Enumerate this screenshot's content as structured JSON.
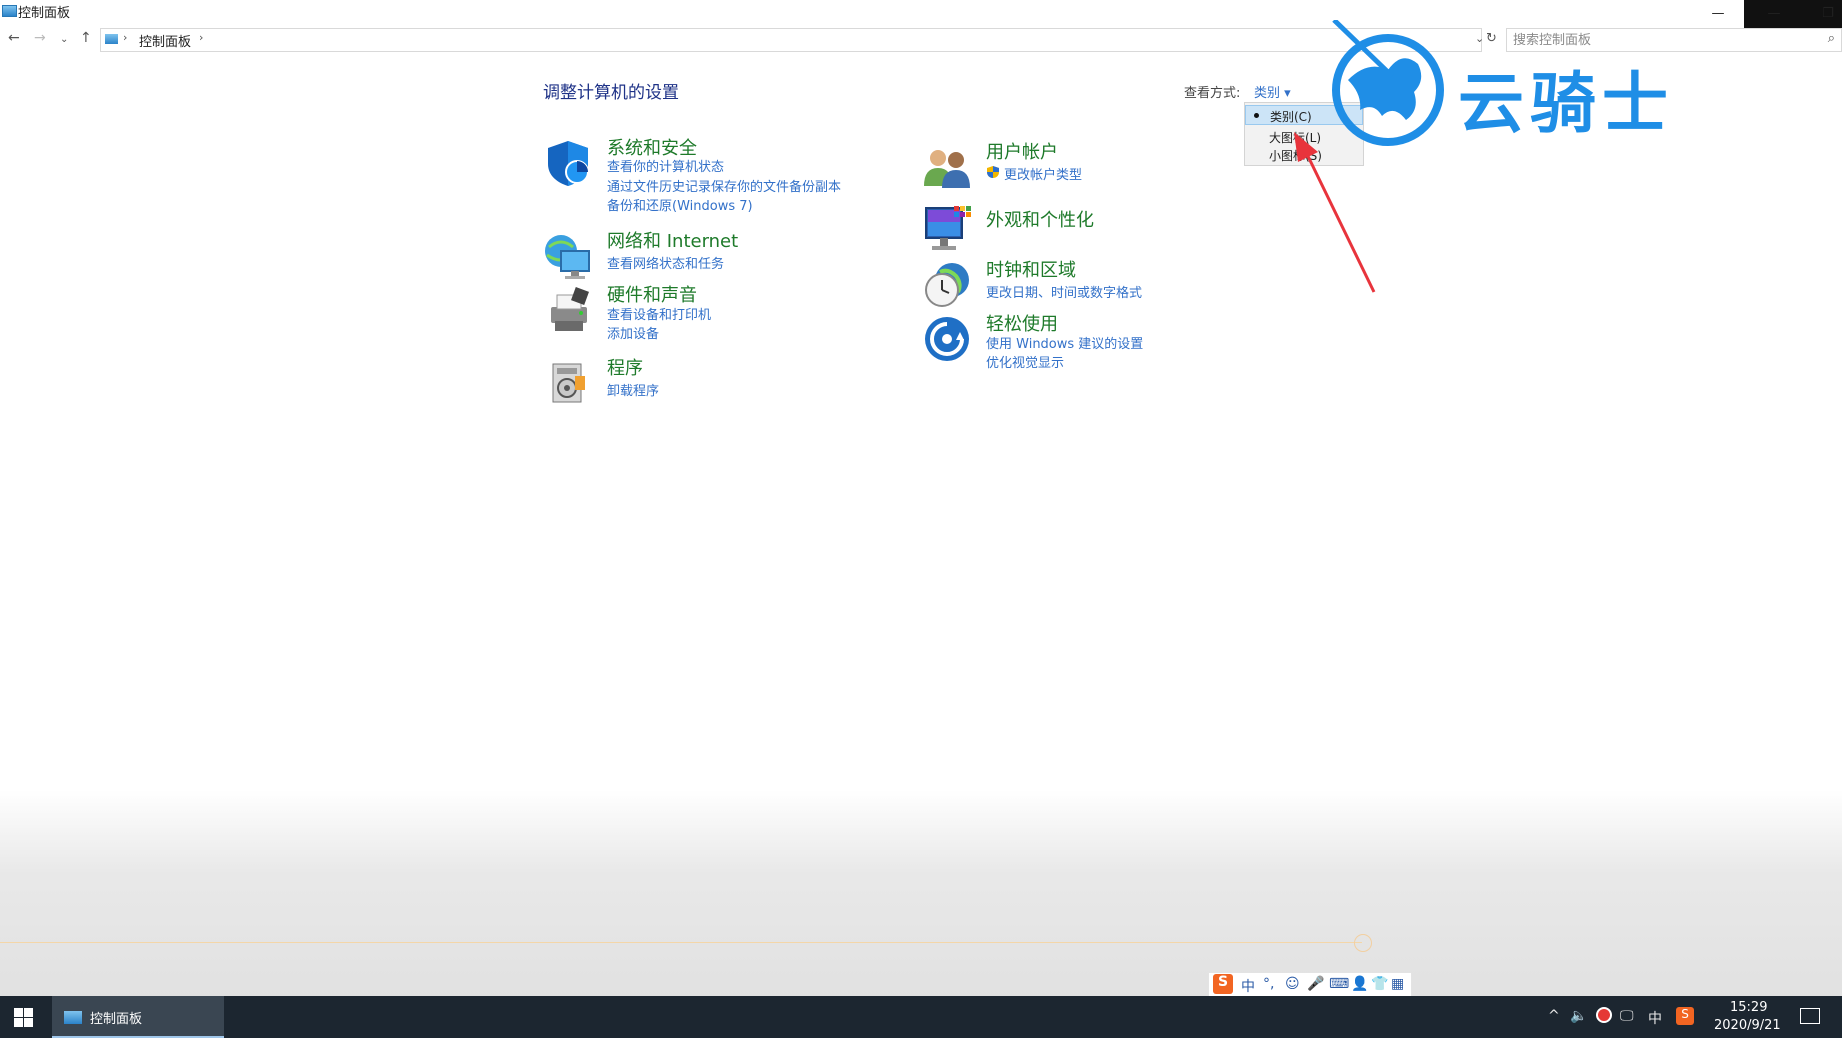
{
  "window": {
    "title": "控制面板",
    "controls": {
      "minimize": "—",
      "minimize_alt": "—",
      "restore": "❐"
    }
  },
  "address_bar": {
    "breadcrumb": "控制面板",
    "search_placeholder": "搜索控制面板"
  },
  "main": {
    "page_title": "调整计算机的设置",
    "view_by_label": "查看方式:",
    "view_by_value": "类别 ▾",
    "categories": [
      {
        "title": "系统和安全",
        "icon": "shield-icon",
        "links": [
          "查看你的计算机状态",
          "通过文件历史记录保存你的文件备份副本",
          "备份和还原(Windows 7)"
        ]
      },
      {
        "title": "网络和 Internet",
        "icon": "network-icon",
        "links": [
          "查看网络状态和任务"
        ]
      },
      {
        "title": "硬件和声音",
        "icon": "printer-icon",
        "links": [
          "查看设备和打印机",
          "添加设备"
        ]
      },
      {
        "title": "程序",
        "icon": "programs-icon",
        "links": [
          "卸载程序"
        ]
      },
      {
        "title": "用户帐户",
        "icon": "users-icon",
        "links": [
          "更改帐户类型"
        ]
      },
      {
        "title": "外观和个性化",
        "icon": "monitor-icon",
        "links": []
      },
      {
        "title": "时钟和区域",
        "icon": "clock-icon",
        "links": [
          "更改日期、时间或数字格式"
        ]
      },
      {
        "title": "轻松使用",
        "icon": "ease-of-access-icon",
        "links": [
          "使用 Windows 建议的设置",
          "优化视觉显示"
        ]
      }
    ]
  },
  "view_menu": {
    "items": [
      "类别(C)",
      "大图标(L)",
      "小图标(S)"
    ],
    "selected": "类别(C)"
  },
  "watermark": {
    "text": "云骑士"
  },
  "ime_bar": {
    "logo": "S",
    "mode": "中",
    "punct": "°,",
    "items": [
      "emoji-icon",
      "mic-icon",
      "keyboard-icon",
      "user-icon",
      "shirt-icon",
      "grid-icon"
    ]
  },
  "taskbar": {
    "task_label": "控制面板",
    "tray": {
      "chevron": "^",
      "volume": "🔈",
      "ime_mode": "中"
    },
    "time": "15:29",
    "date": "2020/9/21"
  },
  "colors": {
    "title_blue": "#1e3287",
    "category_green": "#1e7a2a",
    "link_blue": "#3371c9",
    "taskbar": "#1c2630",
    "watermark_blue": "#1f8ee6"
  }
}
